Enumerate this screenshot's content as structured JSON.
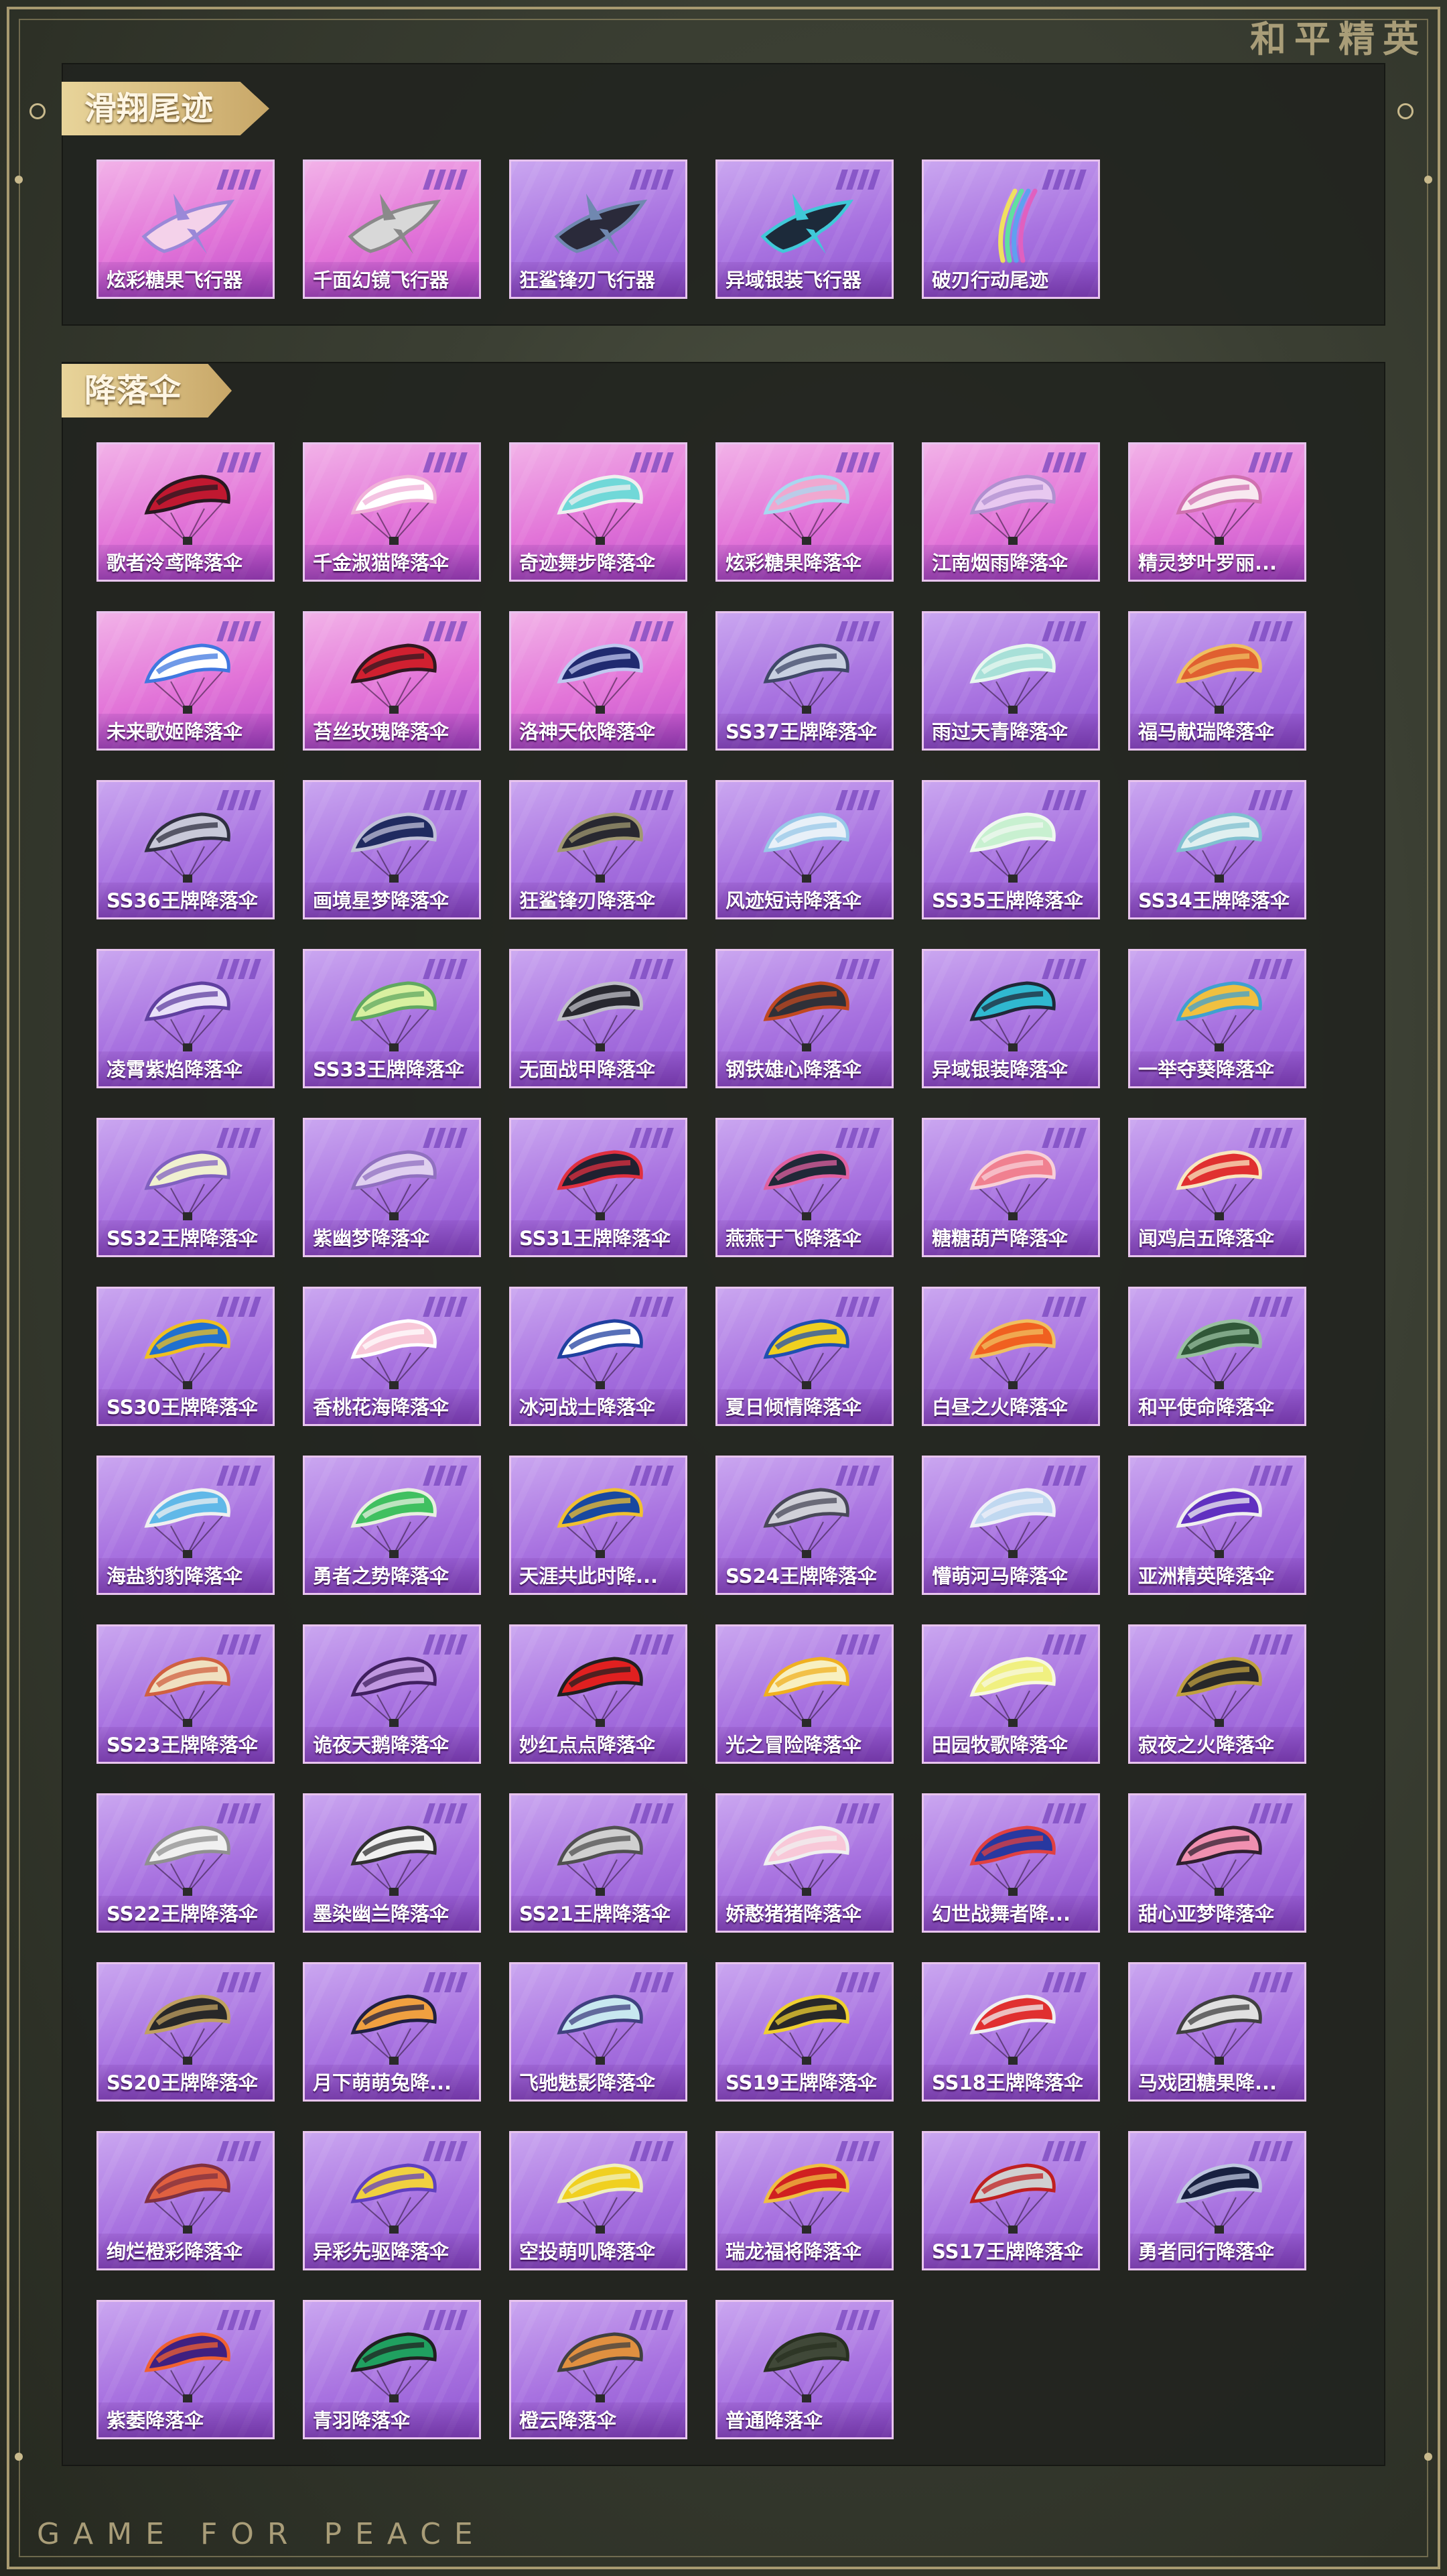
{
  "brand": "和平精英",
  "footer": "GAME FOR PEACE",
  "sections": [
    {
      "title": "滑翔尾迹",
      "items": [
        {
          "label": "炫彩糖果飞行器",
          "tint": "pink",
          "icon": "glider-icon",
          "c1": "#f4d2ea",
          "c2": "#9a88d8"
        },
        {
          "label": "千面幻镜飞行器",
          "tint": "pink",
          "icon": "glider-icon",
          "c1": "#d8d8d8",
          "c2": "#8a8a8a"
        },
        {
          "label": "狂鲨锋刃飞行器",
          "tint": "purple",
          "icon": "glider-icon",
          "c1": "#2a2a3a",
          "c2": "#7088b0"
        },
        {
          "label": "异域银装飞行器",
          "tint": "purple",
          "icon": "glider-icon",
          "c1": "#1c2a3a",
          "c2": "#40c8d8"
        },
        {
          "label": "破刃行动尾迹",
          "tint": "purple",
          "icon": "trail-icon",
          "c1": "#f0e060",
          "c2": "#e060c0"
        }
      ]
    },
    {
      "title": "降落伞",
      "items": [
        {
          "label": "歌者泠鸢降落伞",
          "tint": "pink",
          "icon": "parachute-icon",
          "c1": "#c01830",
          "c2": "#281820"
        },
        {
          "label": "千金淑猫降落伞",
          "tint": "pink",
          "icon": "parachute-icon",
          "c1": "#ffffff",
          "c2": "#f0b0d8"
        },
        {
          "label": "奇迹舞步降落伞",
          "tint": "pink",
          "icon": "parachute-icon",
          "c1": "#70d8d8",
          "c2": "#f0f0f0"
        },
        {
          "label": "炫彩糖果降落伞",
          "tint": "pink",
          "icon": "parachute-icon",
          "c1": "#f0a8d0",
          "c2": "#a8d8f0"
        },
        {
          "label": "江南烟雨降落伞",
          "tint": "pink",
          "icon": "parachute-icon",
          "c1": "#e8c8f0",
          "c2": "#b090d0"
        },
        {
          "label": "精灵梦叶罗丽...",
          "tint": "pink",
          "icon": "parachute-icon",
          "c1": "#f8e8f0",
          "c2": "#d070b0"
        },
        {
          "label": "未来歌姬降落伞",
          "tint": "pink",
          "icon": "parachute-icon",
          "c1": "#ffffff",
          "c2": "#4078e0"
        },
        {
          "label": "苔丝玫瑰降落伞",
          "tint": "pink",
          "icon": "parachute-icon",
          "c1": "#d02030",
          "c2": "#301820"
        },
        {
          "label": "洛神天依降落伞",
          "tint": "pink",
          "icon": "parachute-icon",
          "c1": "#202a70",
          "c2": "#c0c8f0"
        },
        {
          "label": "SS37王牌降落伞",
          "tint": "purple",
          "icon": "parachute-icon",
          "c1": "#c8d0e0",
          "c2": "#404868"
        },
        {
          "label": "雨过天青降落伞",
          "tint": "purple",
          "icon": "parachute-icon",
          "c1": "#a8e0d8",
          "c2": "#e8f8f0"
        },
        {
          "label": "福马献瑞降落伞",
          "tint": "purple",
          "icon": "parachute-icon",
          "c1": "#e06030",
          "c2": "#f0c060"
        },
        {
          "label": "SS36王牌降落伞",
          "tint": "purple",
          "icon": "parachute-icon",
          "c1": "#c8c8d8",
          "c2": "#303040"
        },
        {
          "label": "画境星梦降落伞",
          "tint": "purple",
          "icon": "parachute-icon",
          "c1": "#202a60",
          "c2": "#c0c0d8"
        },
        {
          "label": "狂鲨锋刃降落伞",
          "tint": "purple",
          "icon": "parachute-icon",
          "c1": "#282830",
          "c2": "#a09870"
        },
        {
          "label": "风迹短诗降落伞",
          "tint": "purple",
          "icon": "parachute-icon",
          "c1": "#e8f0f8",
          "c2": "#98c8e8"
        },
        {
          "label": "SS35王牌降落伞",
          "tint": "purple",
          "icon": "parachute-icon",
          "c1": "#c8f0d0",
          "c2": "#f0f8f0"
        },
        {
          "label": "SS34王牌降落伞",
          "tint": "purple",
          "icon": "parachute-icon",
          "c1": "#e0f0f0",
          "c2": "#80c0d0"
        },
        {
          "label": "凌霄紫焰降落伞",
          "tint": "purple",
          "icon": "parachute-icon",
          "c1": "#e8e0f8",
          "c2": "#6040a0"
        },
        {
          "label": "SS33王牌降落伞",
          "tint": "purple",
          "icon": "parachute-icon",
          "c1": "#d8f0a0",
          "c2": "#60a860"
        },
        {
          "label": "无面战甲降落伞",
          "tint": "purple",
          "icon": "parachute-icon",
          "c1": "#282830",
          "c2": "#c0c0c8"
        },
        {
          "label": "钢铁雄心降落伞",
          "tint": "purple",
          "icon": "parachute-icon",
          "c1": "#303038",
          "c2": "#c04820"
        },
        {
          "label": "异域银装降落伞",
          "tint": "purple",
          "icon": "parachute-icon",
          "c1": "#30b8d0",
          "c2": "#202838"
        },
        {
          "label": "一举夺葵降落伞",
          "tint": "purple",
          "icon": "parachute-icon",
          "c1": "#f0c040",
          "c2": "#40a0d0"
        },
        {
          "label": "SS32王牌降落伞",
          "tint": "purple",
          "icon": "parachute-icon",
          "c1": "#f0f0d0",
          "c2": "#8060c0"
        },
        {
          "label": "紫幽梦降落伞",
          "tint": "purple",
          "icon": "parachute-icon",
          "c1": "#e0d0f0",
          "c2": "#9070c0"
        },
        {
          "label": "SS31王牌降落伞",
          "tint": "purple",
          "icon": "parachute-icon",
          "c1": "#202030",
          "c2": "#e03040"
        },
        {
          "label": "燕燕于飞降落伞",
          "tint": "purple",
          "icon": "parachute-icon",
          "c1": "#202838",
          "c2": "#e060a0"
        },
        {
          "label": "糖糖葫芦降落伞",
          "tint": "purple",
          "icon": "parachute-icon",
          "c1": "#f08090",
          "c2": "#f8d0d8"
        },
        {
          "label": "闻鸡启五降落伞",
          "tint": "purple",
          "icon": "parachute-icon",
          "c1": "#e03030",
          "c2": "#f8e8c0"
        },
        {
          "label": "SS30王牌降落伞",
          "tint": "purple",
          "icon": "parachute-icon",
          "c1": "#2070d0",
          "c2": "#f0c020"
        },
        {
          "label": "香桃花海降落伞",
          "tint": "purple",
          "icon": "parachute-icon",
          "c1": "#f8c8d8",
          "c2": "#ffffff"
        },
        {
          "label": "冰河战士降落伞",
          "tint": "purple",
          "icon": "parachute-icon",
          "c1": "#ffffff",
          "c2": "#2040a0"
        },
        {
          "label": "夏日倾情降落伞",
          "tint": "purple",
          "icon": "parachute-icon",
          "c1": "#f0d020",
          "c2": "#2050b0"
        },
        {
          "label": "白昼之火降落伞",
          "tint": "purple",
          "icon": "parachute-icon",
          "c1": "#f06020",
          "c2": "#f0c060"
        },
        {
          "label": "和平使命降落伞",
          "tint": "purple",
          "icon": "parachute-icon",
          "c1": "#305838",
          "c2": "#98c0a0"
        },
        {
          "label": "海盐豹豹降落伞",
          "tint": "purple",
          "icon": "parachute-icon",
          "c1": "#60b8e8",
          "c2": "#f0f0f0"
        },
        {
          "label": "勇者之势降落伞",
          "tint": "purple",
          "icon": "parachute-icon",
          "c1": "#40c060",
          "c2": "#e8f0e0"
        },
        {
          "label": "天涯共此时降...",
          "tint": "purple",
          "icon": "parachute-icon",
          "c1": "#1848a0",
          "c2": "#f0c030"
        },
        {
          "label": "SS24王牌降落伞",
          "tint": "purple",
          "icon": "parachute-icon",
          "c1": "#d0d0d8",
          "c2": "#484858"
        },
        {
          "label": "懵萌河马降落伞",
          "tint": "purple",
          "icon": "parachute-icon",
          "c1": "#c0d8f0",
          "c2": "#f0f0f8"
        },
        {
          "label": "亚洲精英降落伞",
          "tint": "purple",
          "icon": "parachute-icon",
          "c1": "#6030c0",
          "c2": "#f0f0f0"
        },
        {
          "label": "SS23王牌降落伞",
          "tint": "purple",
          "icon": "parachute-icon",
          "c1": "#f0e0c0",
          "c2": "#d06040"
        },
        {
          "label": "诡夜天鹅降落伞",
          "tint": "purple",
          "icon": "parachute-icon",
          "c1": "#c098e0",
          "c2": "#402060"
        },
        {
          "label": "妙红点点降落伞",
          "tint": "purple",
          "icon": "parachute-icon",
          "c1": "#e02020",
          "c2": "#202020"
        },
        {
          "label": "光之冒险降落伞",
          "tint": "purple",
          "icon": "parachute-icon",
          "c1": "#f8f0c0",
          "c2": "#f0b020"
        },
        {
          "label": "田园牧歌降落伞",
          "tint": "purple",
          "icon": "parachute-icon",
          "c1": "#f0f080",
          "c2": "#f8f8e0"
        },
        {
          "label": "寂夜之火降落伞",
          "tint": "purple",
          "icon": "parachute-icon",
          "c1": "#282828",
          "c2": "#c0a040"
        },
        {
          "label": "SS22王牌降落伞",
          "tint": "purple",
          "icon": "parachute-icon",
          "c1": "#f0f0f0",
          "c2": "#909090"
        },
        {
          "label": "墨染幽兰降落伞",
          "tint": "purple",
          "icon": "parachute-icon",
          "c1": "#f0f0f0",
          "c2": "#303030"
        },
        {
          "label": "SS21王牌降落伞",
          "tint": "purple",
          "icon": "parachute-icon",
          "c1": "#d0d0d0",
          "c2": "#505050"
        },
        {
          "label": "娇憨猪猪降落伞",
          "tint": "purple",
          "icon": "parachute-icon",
          "c1": "#f8c8d8",
          "c2": "#f0f0f0"
        },
        {
          "label": "幻世战舞者降...",
          "tint": "purple",
          "icon": "parachute-icon",
          "c1": "#2838a0",
          "c2": "#e04040"
        },
        {
          "label": "甜心亚梦降落伞",
          "tint": "purple",
          "icon": "parachute-icon",
          "c1": "#f090b0",
          "c2": "#302030"
        },
        {
          "label": "SS20王牌降落伞",
          "tint": "purple",
          "icon": "parachute-icon",
          "c1": "#282828",
          "c2": "#c0a060"
        },
        {
          "label": "月下萌萌兔降...",
          "tint": "purple",
          "icon": "parachute-icon",
          "c1": "#f0a040",
          "c2": "#202040"
        },
        {
          "label": "飞驰魅影降落伞",
          "tint": "purple",
          "icon": "parachute-icon",
          "c1": "#c8e8f0",
          "c2": "#404080"
        },
        {
          "label": "SS19王牌降落伞",
          "tint": "purple",
          "icon": "parachute-icon",
          "c1": "#282828",
          "c2": "#f0d030"
        },
        {
          "label": "SS18王牌降落伞",
          "tint": "purple",
          "icon": "parachute-icon",
          "c1": "#e03030",
          "c2": "#f0f0f0"
        },
        {
          "label": "马戏团糖果降...",
          "tint": "purple",
          "icon": "parachute-icon",
          "c1": "#e0e0e0",
          "c2": "#404040"
        },
        {
          "label": "绚烂橙彩降落伞",
          "tint": "purple",
          "icon": "parachute-icon",
          "c1": "#e06040",
          "c2": "#803040"
        },
        {
          "label": "异彩先驱降落伞",
          "tint": "purple",
          "icon": "parachute-icon",
          "c1": "#f0d040",
          "c2": "#6040c0"
        },
        {
          "label": "空投萌叽降落伞",
          "tint": "purple",
          "icon": "parachute-icon",
          "c1": "#f0d020",
          "c2": "#f0f0c0"
        },
        {
          "label": "瑞龙福将降落伞",
          "tint": "purple",
          "icon": "parachute-icon",
          "c1": "#d02020",
          "c2": "#f0c040"
        },
        {
          "label": "SS17王牌降落伞",
          "tint": "purple",
          "icon": "parachute-icon",
          "c1": "#d0d0d0",
          "c2": "#c02020"
        },
        {
          "label": "勇者同行降落伞",
          "tint": "purple",
          "icon": "parachute-icon",
          "c1": "#182040",
          "c2": "#c0c8e0"
        },
        {
          "label": "紫萎降落伞",
          "tint": "purple",
          "icon": "parachute-icon",
          "c1": "#402080",
          "c2": "#f06030"
        },
        {
          "label": "青羽降落伞",
          "tint": "purple",
          "icon": "parachute-icon",
          "c1": "#20a060",
          "c2": "#202020"
        },
        {
          "label": "橙云降落伞",
          "tint": "purple",
          "icon": "parachute-icon",
          "c1": "#e09040",
          "c2": "#404040"
        },
        {
          "label": "普通降落伞",
          "tint": "purple",
          "icon": "parachute-icon",
          "c1": "#404838",
          "c2": "#283020"
        }
      ]
    }
  ]
}
